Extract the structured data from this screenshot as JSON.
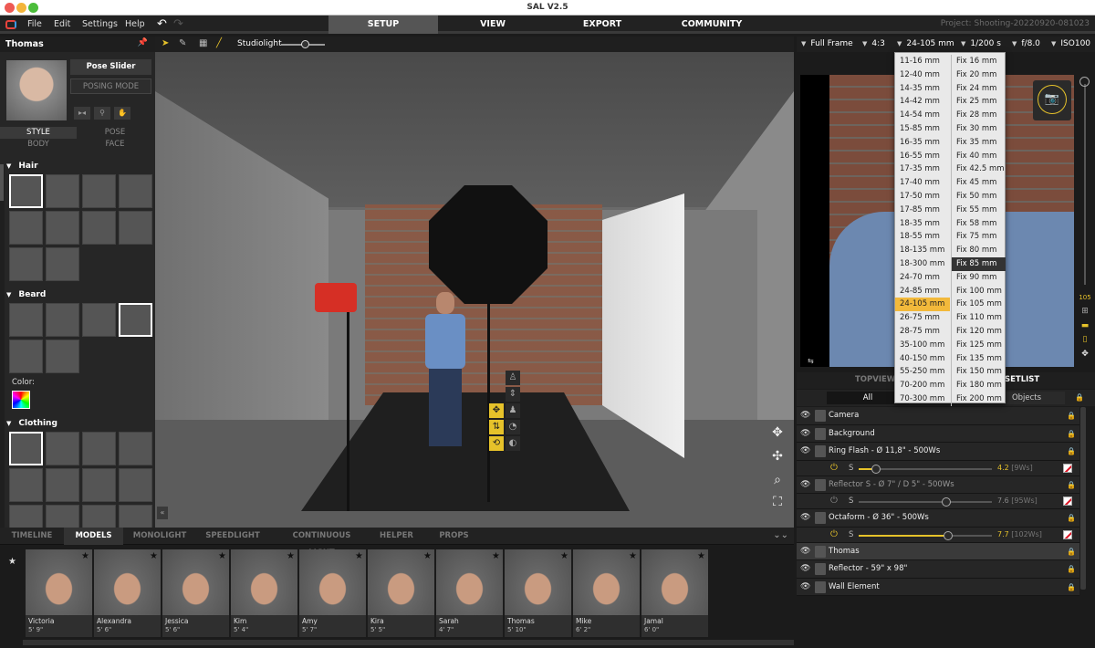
{
  "window": {
    "title": "SAL V2.5"
  },
  "menu": {
    "items": [
      "File",
      "Edit",
      "Settings",
      "Help"
    ]
  },
  "main_tabs": [
    {
      "label": "SETUP",
      "active": true
    },
    {
      "label": "VIEW",
      "active": false
    },
    {
      "label": "EXPORT",
      "active": false
    },
    {
      "label": "COMMUNITY",
      "active": false
    }
  ],
  "project": "Project: Shooting-20220920-081023",
  "left_panel": {
    "title": "Thomas",
    "pose_slider": "Pose Slider",
    "posing_mode": "POSING MODE",
    "subtabs": [
      {
        "label": "STYLE",
        "active": true
      },
      {
        "label": "POSE",
        "active": false
      },
      {
        "label": "BODY",
        "active": false
      },
      {
        "label": "FACE",
        "active": false
      }
    ],
    "sections": {
      "hair": {
        "label": "Hair",
        "count": 10,
        "selected": 0
      },
      "beard": {
        "label": "Beard",
        "count": 6,
        "selected": 3
      },
      "color_label": "Color:",
      "clothing": {
        "label": "Clothing",
        "count": 12,
        "selected": 0
      }
    }
  },
  "viewport": {
    "light_label": "Studiolight",
    "light_level": 0.55
  },
  "bottom_tabs": [
    {
      "label": "TIMELINE",
      "active": false
    },
    {
      "label": "MODELS",
      "active": true
    },
    {
      "label": "MONOLIGHT",
      "active": false
    },
    {
      "label": "SPEEDLIGHT",
      "active": false
    },
    {
      "label": "CONTINUOUS LIGHT",
      "active": false
    },
    {
      "label": "HELPER",
      "active": false
    },
    {
      "label": "PROPS",
      "active": false
    }
  ],
  "models": [
    {
      "name": "Victoria",
      "height": "5' 9\""
    },
    {
      "name": "Alexandra",
      "height": "5' 6\""
    },
    {
      "name": "Jessica",
      "height": "5' 6\""
    },
    {
      "name": "Kim",
      "height": "5' 4\""
    },
    {
      "name": "Amy",
      "height": "5' 7\""
    },
    {
      "name": "Kira",
      "height": "5' 5\""
    },
    {
      "name": "Sarah",
      "height": "4' 7\""
    },
    {
      "name": "Thomas",
      "height": "5' 10\""
    },
    {
      "name": "Mike",
      "height": "6' 2\""
    },
    {
      "name": "Jamal",
      "height": "6' 0\""
    }
  ],
  "camera": {
    "sensor": "Full Frame",
    "ratio": "4:3",
    "lens": "24-105 mm",
    "shutter": "1/200 s",
    "aperture": "f/8.0",
    "iso": "ISO100"
  },
  "lens_dropdown": {
    "zooms": [
      "11-16 mm",
      "12-40 mm",
      "14-35 mm",
      "14-42 mm",
      "14-54 mm",
      "15-85 mm",
      "16-35 mm",
      "16-55 mm",
      "17-35 mm",
      "17-40 mm",
      "17-50 mm",
      "17-85 mm",
      "18-35 mm",
      "18-55 mm",
      "18-135 mm",
      "18-300 mm",
      "24-70 mm",
      "24-85 mm",
      "24-105 mm",
      "26-75 mm",
      "28-75 mm",
      "35-100 mm",
      "40-150 mm",
      "55-250 mm",
      "70-200 mm",
      "70-300 mm"
    ],
    "primes": [
      "Fix 16 mm",
      "Fix 20 mm",
      "Fix 24 mm",
      "Fix 25 mm",
      "Fix 28 mm",
      "Fix 30 mm",
      "Fix 35 mm",
      "Fix 40 mm",
      "Fix 42.5 mm",
      "Fix 45 mm",
      "Fix 50 mm",
      "Fix 55 mm",
      "Fix 58 mm",
      "Fix 75 mm",
      "Fix 80 mm",
      "Fix 85 mm",
      "Fix 90 mm",
      "Fix 100 mm",
      "Fix 105 mm",
      "Fix 110 mm",
      "Fix 120 mm",
      "Fix 125 mm",
      "Fix 135 mm",
      "Fix 150 mm",
      "Fix 180 mm",
      "Fix 200 mm"
    ],
    "current": "24-105 mm",
    "hovered": "Fix 85 mm"
  },
  "preview_side": {
    "focal_readout": "105"
  },
  "view_tabs": {
    "topview": "TOPVIEW",
    "setlist": "SETLIST"
  },
  "filters": {
    "all": "All",
    "objects": "Objects"
  },
  "setlist": [
    {
      "label": "Camera",
      "type": "item"
    },
    {
      "label": "Background",
      "type": "item"
    },
    {
      "label": "Ring Flash - Ø 11,8\" - 500Ws",
      "type": "light",
      "power_on": true,
      "mode": "S",
      "level": 0.13,
      "value": "4.2",
      "ws": "[9Ws]"
    },
    {
      "label": "Reflector S - Ø 7\" / D 5\" - 500Ws",
      "type": "light",
      "power_on": false,
      "mode": "S",
      "level": 0.66,
      "value": "7.6",
      "ws": "[95Ws]"
    },
    {
      "label": "Octaform - Ø 36\" - 500Ws",
      "type": "light",
      "power_on": true,
      "mode": "S",
      "level": 0.67,
      "value": "7.7",
      "ws": "[102Ws]"
    },
    {
      "label": "Thomas",
      "type": "item",
      "highlighted": true
    },
    {
      "label": "Reflector - 59\" x 98\"",
      "type": "item"
    },
    {
      "label": "Wall Element",
      "type": "item"
    }
  ],
  "colors": {
    "accent": "#e6c22a",
    "dropdown_selected": "#f2b93b"
  }
}
